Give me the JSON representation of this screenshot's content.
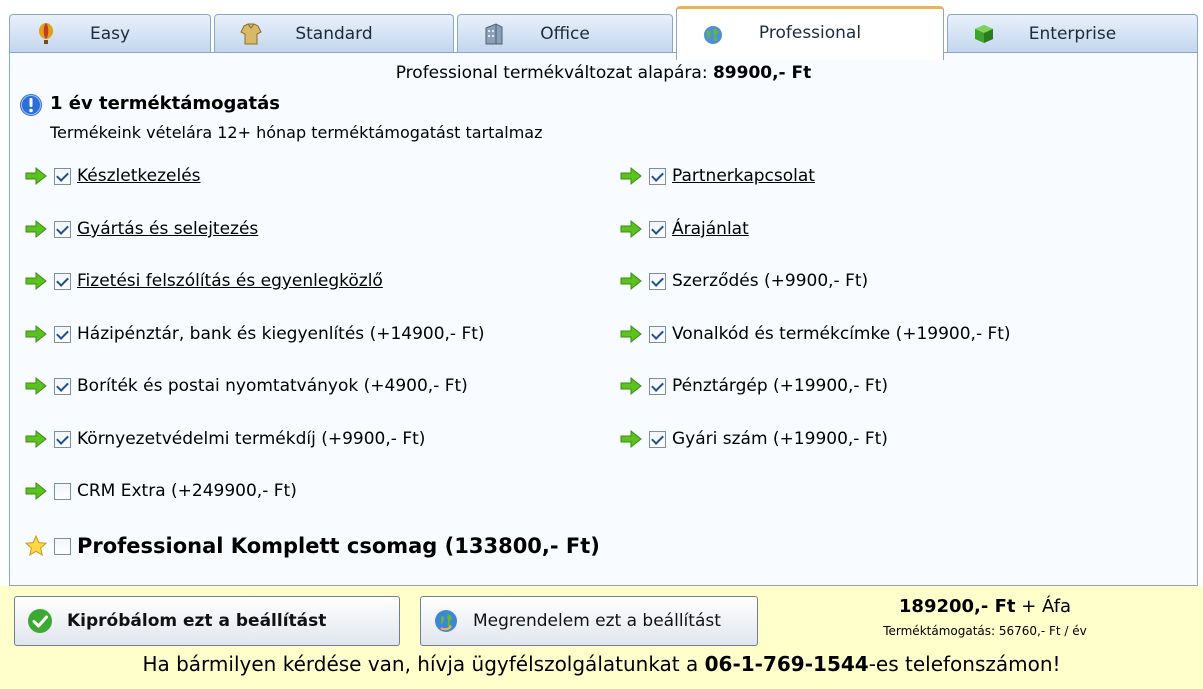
{
  "tabs": [
    {
      "label": "Easy",
      "icon": "balloon-icon"
    },
    {
      "label": "Standard",
      "icon": "sweater-icon"
    },
    {
      "label": "Office",
      "icon": "office-building-icon"
    },
    {
      "label": "Professional",
      "icon": "globe-icon",
      "active": true
    },
    {
      "label": "Enterprise",
      "icon": "green-cube-icon"
    }
  ],
  "panel": {
    "base_price_prefix": "Professional termékváltozat alapára: ",
    "base_price_value": "89900,- Ft",
    "support_title": "1 év terméktámogatás",
    "support_subtitle": "Termékeink vételára 12+ hónap terméktámogatást tartalmaz",
    "options_left": [
      {
        "label": "Készletkezelés",
        "checked": true,
        "link": true
      },
      {
        "label": "Gyártás és selejtezés",
        "checked": true,
        "link": true
      },
      {
        "label": "Fizetési felszólítás és egyenlegközlő",
        "checked": true,
        "link": true
      },
      {
        "label": "Házipénztár, bank és kiegyenlítés (+14900,- Ft)",
        "checked": true,
        "link": false
      },
      {
        "label": "Boríték és postai nyomtatványok (+4900,- Ft)",
        "checked": true,
        "link": false
      },
      {
        "label": "Környezetvédelmi termékdíj (+9900,- Ft)",
        "checked": true,
        "link": false
      },
      {
        "label": "CRM Extra (+249900,- Ft)",
        "checked": false,
        "link": false
      }
    ],
    "options_right": [
      {
        "label": "Partnerkapcsolat",
        "checked": true,
        "link": true
      },
      {
        "label": "Árajánlat",
        "checked": true,
        "link": true
      },
      {
        "label": "Szerződés (+9900,- Ft)",
        "checked": true,
        "link": false
      },
      {
        "label": "Vonalkód és termékcímke (+19900,- Ft)",
        "checked": true,
        "link": false
      },
      {
        "label": "Pénztárgép (+19900,- Ft)",
        "checked": true,
        "link": false
      },
      {
        "label": "Gyári szám (+19900,- Ft)",
        "checked": true,
        "link": false
      }
    ],
    "bundle": {
      "label": "Professional Komplett csomag (133800,- Ft)",
      "checked": false
    }
  },
  "bottom": {
    "try_button": "Kipróbálom ezt a beállítást",
    "order_button": "Megrendelem ezt a beállítást",
    "total_value": "189200,- Ft",
    "total_suffix": " + Áfa",
    "support_fee": "Terméktámogatás: 56760,- Ft / év",
    "help_prefix": "Ha bármilyen kérdése van, hívja ügyfélszolgálatunkat a ",
    "help_phone": "06-1-769-1544",
    "help_suffix": "-es telefonszámon!"
  },
  "colors": {
    "accent_tab": "#f2b24a",
    "bottom_bg": "#ffffcc",
    "arrow_green": "#5cc21f",
    "info_blue": "#2d6fd6"
  }
}
